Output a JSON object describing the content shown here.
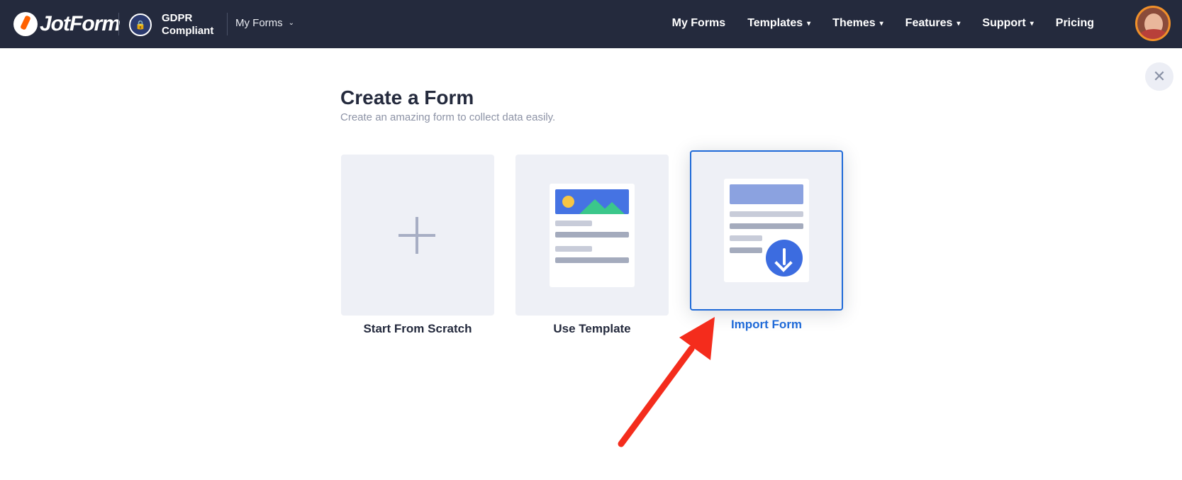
{
  "header": {
    "logo_text": "JotForm",
    "gdpr_line1": "GDPR",
    "gdpr_line2": "Compliant",
    "my_forms_dropdown": "My Forms",
    "nav": [
      {
        "label": "My Forms",
        "has_caret": false
      },
      {
        "label": "Templates",
        "has_caret": true
      },
      {
        "label": "Themes",
        "has_caret": true
      },
      {
        "label": "Features",
        "has_caret": true
      },
      {
        "label": "Support",
        "has_caret": true
      },
      {
        "label": "Pricing",
        "has_caret": false
      }
    ],
    "caret_glyph": "▾",
    "background": "#242a3d"
  },
  "main": {
    "title": "Create a Form",
    "subtitle": "Create an amazing form to collect data easily.",
    "close_glyph": "✕",
    "options": [
      {
        "label": "Start From Scratch",
        "icon": "plus-icon",
        "selected": false
      },
      {
        "label": "Use Template",
        "icon": "template-preview-icon",
        "selected": false
      },
      {
        "label": "Import Form",
        "icon": "import-download-icon",
        "selected": true
      }
    ],
    "accent_color": "#1f6ad8"
  },
  "annotation": {
    "pointer": "red-arrow",
    "color": "#f42c1c"
  }
}
